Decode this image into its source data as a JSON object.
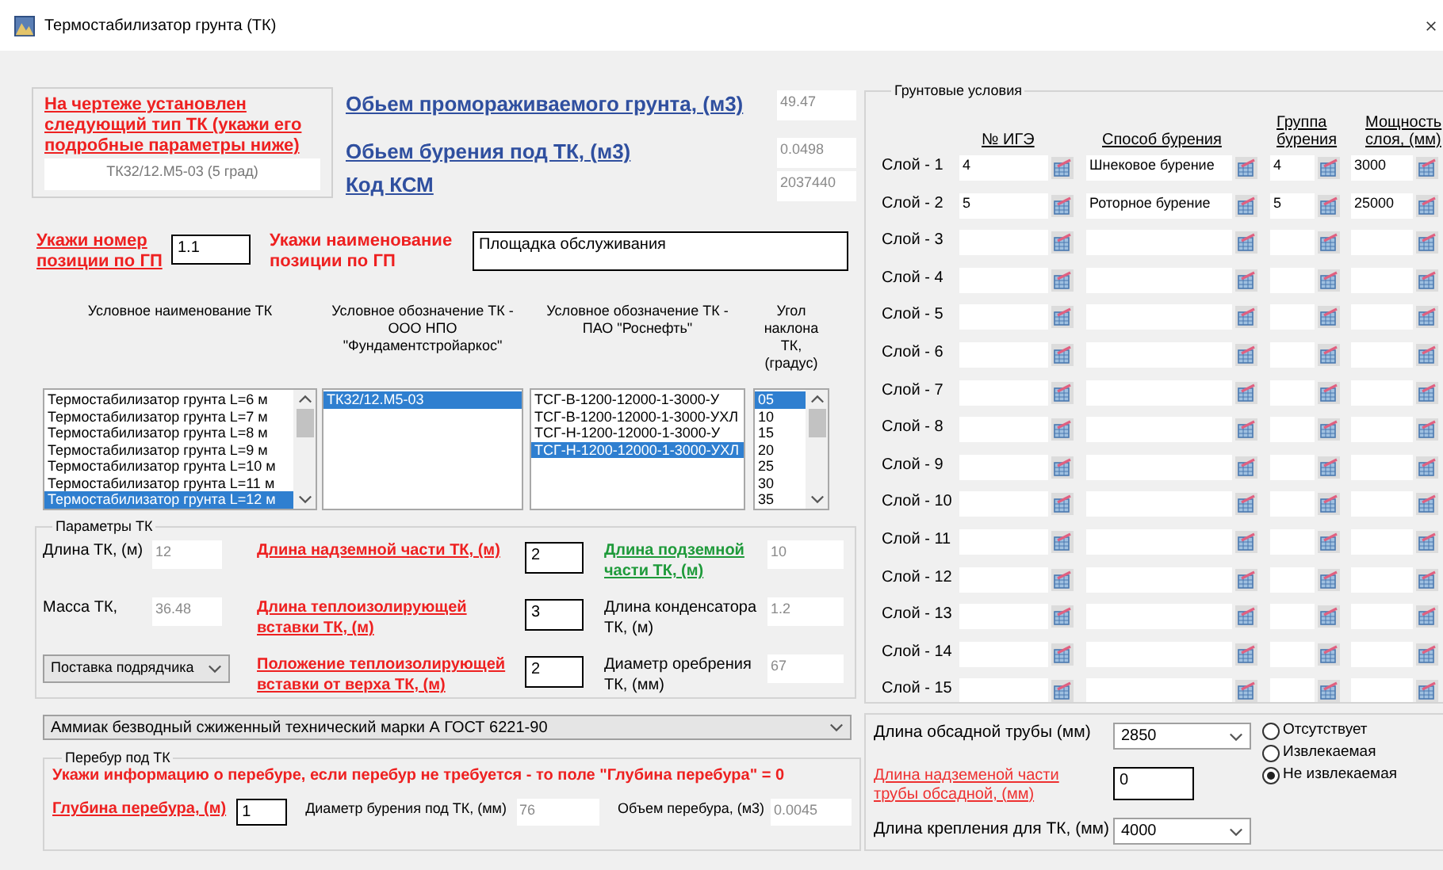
{
  "window": {
    "title": "Термостабилизатор грунта (ТК)"
  },
  "tk_type": {
    "heading": "На чертеже установлен следующий тип ТК (укажи его подробные параметры ниже)",
    "value": "ТК32/12.М5-03 (5 град)"
  },
  "summary": [
    {
      "label": "Обьем промораживаемого грунта, (м3)",
      "value": "49.47"
    },
    {
      "label": "Обьем бурения под ТК, (м3)",
      "value": "0.0498"
    },
    {
      "label": "Код КСМ",
      "value": "2037440"
    }
  ],
  "position": {
    "number_label": "Укажи номер позиции по ГП",
    "number_value": "1.1",
    "name_label": "Укажи наименование позиции по ГП",
    "name_value": "Площадка обслуживания"
  },
  "lists": [
    {
      "header": "Условное наименование ТК",
      "scrollbar": true,
      "items": [
        {
          "text": "Термостабилизатор грунта L=6 м",
          "selected": false
        },
        {
          "text": "Термостабилизатор грунта L=7 м",
          "selected": false
        },
        {
          "text": "Термостабилизатор грунта L=8 м",
          "selected": false
        },
        {
          "text": "Термостабилизатор грунта L=9 м",
          "selected": false
        },
        {
          "text": "Термостабилизатор грунта L=10 м",
          "selected": false
        },
        {
          "text": "Термостабилизатор грунта L=11 м",
          "selected": false
        },
        {
          "text": "Термостабилизатор грунта L=12 м",
          "selected": true
        }
      ]
    },
    {
      "header": "Условное обозначение ТК - ООО НПО \"Фундаментстройаркос\"",
      "scrollbar": false,
      "items": [
        {
          "text": "ТК32/12.М5-03",
          "selected": true
        }
      ]
    },
    {
      "header": "Условное обозначение ТК - ПАО \"Роснефть\"",
      "scrollbar": false,
      "items": [
        {
          "text": "ТСГ-В-1200-12000-1-3000-У",
          "selected": false
        },
        {
          "text": "ТСГ-В-1200-12000-1-3000-УХЛ",
          "selected": false
        },
        {
          "text": "ТСГ-Н-1200-12000-1-3000-У",
          "selected": false
        },
        {
          "text": "ТСГ-Н-1200-12000-1-3000-УХЛ",
          "selected": true
        }
      ]
    },
    {
      "header": "Угол наклона ТК, (градус)",
      "scrollbar": true,
      "items": [
        {
          "text": "05",
          "selected": true
        },
        {
          "text": "10",
          "selected": false
        },
        {
          "text": "15",
          "selected": false
        },
        {
          "text": "20",
          "selected": false
        },
        {
          "text": "25",
          "selected": false
        },
        {
          "text": "30",
          "selected": false
        },
        {
          "text": "35",
          "selected": false
        }
      ]
    }
  ],
  "parameters": {
    "title": "Параметры ТК",
    "fields": [
      {
        "kind": "readonly",
        "label": {
          "text": "Длина ТК, (м)",
          "kind": "plain"
        },
        "value": "12"
      },
      {
        "kind": "input",
        "label": {
          "text": "Длина надземной части ТК, (м)",
          "kind": "required"
        },
        "value": "2"
      },
      {
        "kind": "readonly",
        "label": {
          "text": "Длина подземной части ТК, (м)",
          "kind": "confirmed"
        },
        "value": "10"
      },
      {
        "kind": "readonly",
        "label": {
          "text": "Масса ТК,",
          "kind": "plain"
        },
        "value": "36.48"
      },
      {
        "kind": "input",
        "label": {
          "text": "Длина теплоизолирующей вставки ТК, (м)",
          "kind": "required"
        },
        "value": "3"
      },
      {
        "kind": "readonly",
        "label": {
          "text": "Длина конденсатора ТК, (м)",
          "kind": "plain"
        },
        "value": "1.2"
      },
      {
        "kind": "dropdown",
        "value": "Поставка подрядчика"
      },
      {
        "kind": "input",
        "label": {
          "text": "Положение теплоизолирующей вставки от верха ТК, (м)",
          "kind": "required"
        },
        "value": "2"
      },
      {
        "kind": "readonly",
        "label": {
          "text": "Диаметр оребрения ТК, (мм)",
          "kind": "plain"
        },
        "value": "67"
      }
    ]
  },
  "coolant": {
    "value": "Аммиак безводный сжиженный технический марки А ГОСТ 6221-90"
  },
  "overdrill": {
    "title": "Перебур под ТК",
    "message": "Укажи информацию о перебуре, если перебур не требуется - то поле \"Глубина перебура\" = 0",
    "fields": [
      {
        "kind": "input",
        "label": {
          "text": "Глубина перебура, (м)",
          "kind": "required"
        },
        "value": "1"
      },
      {
        "kind": "readonly",
        "label": {
          "text": "Диаметр бурения под ТК, (мм)",
          "kind": "plain"
        },
        "value": "76"
      },
      {
        "kind": "readonly",
        "label": {
          "text": "Объем перебура, (м3)",
          "kind": "plain"
        },
        "value": "0.0045"
      }
    ]
  },
  "soil": {
    "title": "Грунтовые условия",
    "columns": [
      "№ ИГЭ",
      "Способ бурения",
      "Группа бурения",
      "Мощность слоя, (мм)"
    ],
    "rows": [
      {
        "label": "Слой - 1",
        "values": [
          "4",
          "Шнековое бурение",
          "4",
          "3000"
        ]
      },
      {
        "label": "Слой - 2",
        "values": [
          "5",
          "Роторное бурение",
          "5",
          "25000"
        ]
      },
      {
        "label": "Слой - 3"
      },
      {
        "label": "Слой - 4"
      },
      {
        "label": "Слой - 5"
      },
      {
        "label": "Слой - 6"
      },
      {
        "label": "Слой - 7"
      },
      {
        "label": "Слой - 8"
      },
      {
        "label": "Слой - 9"
      },
      {
        "label": "Слой - 10"
      },
      {
        "label": "Слой - 11"
      },
      {
        "label": "Слой - 12"
      },
      {
        "label": "Слой - 13"
      },
      {
        "label": "Слой - 14"
      },
      {
        "label": "Слой - 15"
      }
    ]
  },
  "casing": {
    "length_label": "Длина обсадной трубы (мм)",
    "length_value": "2850",
    "above_label": "Длина надземеной части трубы обсадной, (мм)",
    "above_value": "0",
    "options": [
      {
        "label": "Отсутствует",
        "selected": false
      },
      {
        "label": "Извлекаемая",
        "selected": false
      },
      {
        "label": "Не извлекаемая",
        "selected": true
      }
    ],
    "mount_label": "Длина крепления для ТК, (мм)",
    "mount_value": "4000"
  }
}
